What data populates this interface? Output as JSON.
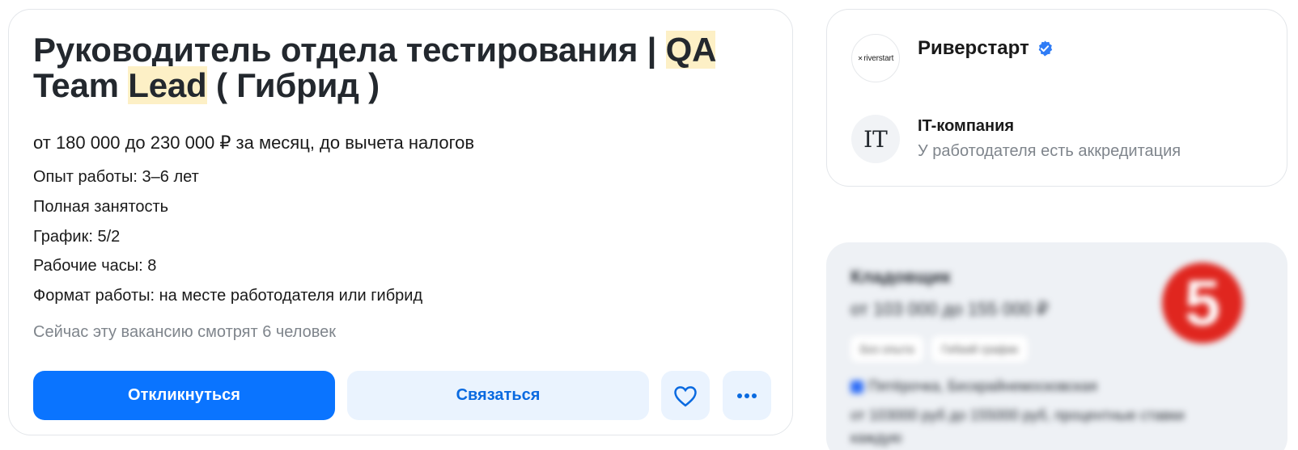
{
  "vacancy": {
    "title_part1": "Руководитель отдела тестирования | ",
    "title_hl1": "QA",
    "title_part2": " Team ",
    "title_hl2": "Lead",
    "title_part3": " ( Гибрид )",
    "salary": "от 180 000 до 230 000 ₽ за месяц, до вычета налогов",
    "details": [
      "Опыт работы: 3–6 лет",
      "Полная занятость",
      "График: 5/2",
      "Рабочие часы: 8",
      "Формат работы: на месте работодателя или гибрид"
    ],
    "viewers": "Сейчас эту вакансию смотрят 6 человек",
    "highlight_color": "#fdf0c6"
  },
  "actions": {
    "apply_label": "Откликнуться",
    "contact_label": "Связаться",
    "favorite_icon": "heart-icon",
    "more_icon": "more-dots-icon",
    "accent_color": "#0a74ff"
  },
  "company": {
    "logo_text": "riverstart",
    "name": "Риверстарт",
    "verified_icon": "verified-check-icon",
    "badge_text": "IT",
    "type": "IT-компания",
    "accreditation": "У работодателя есть аккредитация"
  },
  "ad": {
    "title": "Кладовщик",
    "salary": "от 103 000 до 155 000 ₽",
    "tags": [
      "Без опыта",
      "Гибкий график"
    ],
    "line1": "Пятёрочка, Бескрайнемосковская",
    "line2": "от 103000 руб до 155000 руб, процентные ставки",
    "line3": "каждую",
    "logo_text": "5"
  }
}
